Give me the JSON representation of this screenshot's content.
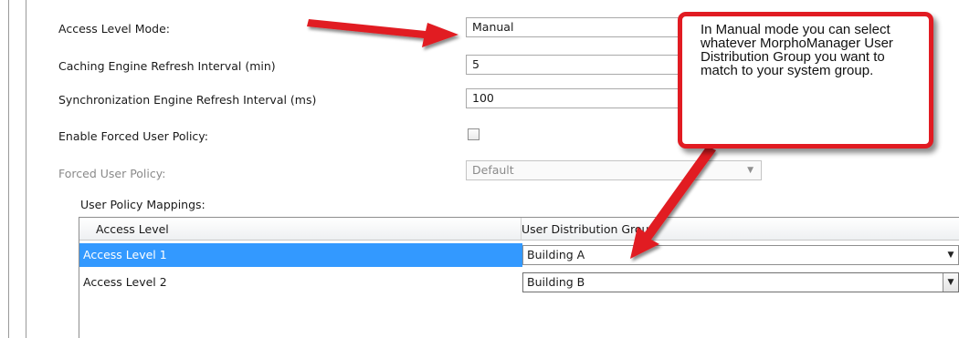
{
  "form": {
    "access_level_mode_label": "Access Level Mode:",
    "access_level_mode_value": "Manual",
    "caching_label": "Caching Engine Refresh Interval (min)",
    "caching_value": "5",
    "sync_label": "Synchronization Engine Refresh Interval (ms)",
    "sync_value": "100",
    "enable_forced_label": "Enable Forced User Policy:",
    "enable_forced_checked": false,
    "forced_policy_label": "Forced User Policy:",
    "forced_policy_value": "Default"
  },
  "mappings": {
    "label": "User Policy Mappings:",
    "columns": [
      "Access Level",
      "User Distribution Group"
    ],
    "rows": [
      {
        "access_level": "Access Level 1",
        "group": "Building A",
        "selected": true
      },
      {
        "access_level": "Access Level 2",
        "group": "Building B",
        "selected": false
      }
    ]
  },
  "callout": {
    "text": "In Manual mode you can select whatever MorphoManager User Distribution Group you want to match to your system group."
  },
  "colors": {
    "selection": "#3399ff",
    "callout_border": "#e11b22",
    "arrow": "#e11b22"
  },
  "icons": [
    "chevron-down-icon",
    "red-arrow-annotation"
  ]
}
